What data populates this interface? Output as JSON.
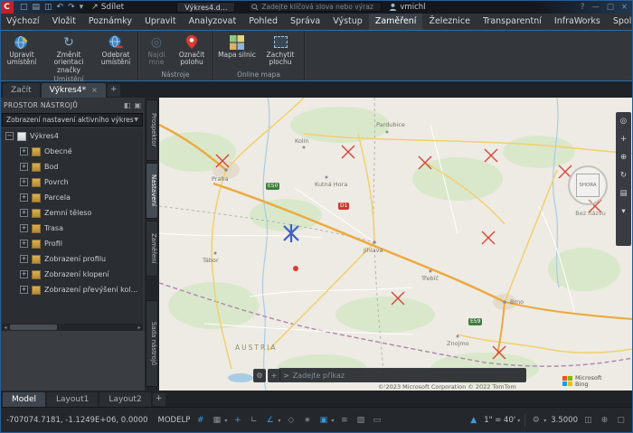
{
  "titlebar": {
    "app_name": "C",
    "share_label": "Sdílet",
    "doc_tab": "Výkres4.d...",
    "search_placeholder": "Zadejte klíčová slova nebo výraz",
    "user_name": "vmichl"
  },
  "menubar": {
    "tabs": [
      "Výchozí",
      "Vložit",
      "Poznámky",
      "Upravit",
      "Analyzovat",
      "Pohled",
      "Správa",
      "Výstup",
      "Zaměření",
      "Železnice",
      "Transparentní",
      "InfraWorks",
      "Spolupráce"
    ]
  },
  "ribbon": {
    "buttons": {
      "edit_location": "Upravit umístění",
      "change_orientation": "Změnit orientaci značky",
      "remove_location": "Odebrat umístění",
      "find_me": "Najdi mne",
      "mark_position": "Označit polohu",
      "road_map": "Mapa silnic",
      "capture_area": "Zachytit plochu"
    },
    "groups": [
      "Umístění",
      "Nástroje",
      "Online mapa"
    ]
  },
  "file_tabs": {
    "start_tab": "Začít",
    "drawing_tab": "Výkres4*"
  },
  "toolspace": {
    "title": "PROSTOR NÁSTROJŮ",
    "dropdown_value": "Zobrazení nastavení aktivního výkresu",
    "tree": {
      "root": "Výkres4",
      "items": [
        "Obecné",
        "Bod",
        "Povrch",
        "Parcela",
        "Zemní těleso",
        "Trasa",
        "Profil",
        "Zobrazení profilu",
        "Zobrazení klopení",
        "Zobrazení převýšení kol..."
      ]
    },
    "side_tabs": [
      "Prospektor",
      "Nastavení",
      "Zaměření",
      "Sada nástrojů"
    ]
  },
  "map": {
    "compass_label": "SHORA",
    "view_label": "Bez názvu",
    "country_label": "AUSTRIA",
    "cities": [
      "Praha",
      "Kolín",
      "Kutná Hora",
      "Pardubice",
      "Jihlava",
      "Třebíč",
      "Tábor",
      "Brno",
      "Znojmo"
    ],
    "shields": [
      "D1",
      "E50",
      "E59"
    ],
    "copyright": "© 2023 Microsoft Corporation © 2022 TomTom",
    "logo_line1": "Microsoft",
    "logo_line2": "Bing"
  },
  "command_line": {
    "placeholder": "Zadejte příkaz"
  },
  "layout_tabs": {
    "tabs": [
      "Model",
      "Layout1",
      "Layout2"
    ]
  },
  "statusbar": {
    "coords": "-707074.7181, -1.1249E+06, 0.0000",
    "mode_label": "MODELP",
    "scale_label": "1\" = 40'",
    "value": "3.5000"
  },
  "icons": {
    "new": "□",
    "open": "▤",
    "save": "◫",
    "undo": "↶",
    "redo": "↷",
    "dropdown": "▾",
    "share": "↗",
    "help": "?",
    "minimize": "—",
    "maximize": "□",
    "close": "×",
    "menu_grid": "▣",
    "menu_caret": "▾",
    "panel_min": "◧",
    "panel_menu": "▣",
    "expand": "+",
    "collapse": "−",
    "dd_arrow": "▼",
    "orientation": "↻",
    "find_me": "◎",
    "grid": "#",
    "snap": "▦",
    "dyn": "+",
    "ortho": "∟",
    "polar": "∠",
    "iso": "◇",
    "otrack": "∗",
    "osnap": "▣",
    "lwt": "≡",
    "transp": "▨",
    "select": "▭",
    "annot": "▲",
    "gear": "⚙",
    "isolate": "◫",
    "target": "⊕",
    "clean": "▢",
    "wheel": "◎",
    "pan": "+",
    "zoom": "⊕",
    "orbit": "↻",
    "list": "▤",
    "wrench": "⚙",
    "prompt": ">",
    "plus": "+",
    "scroll_left": "◂",
    "scroll_right": "▸"
  }
}
